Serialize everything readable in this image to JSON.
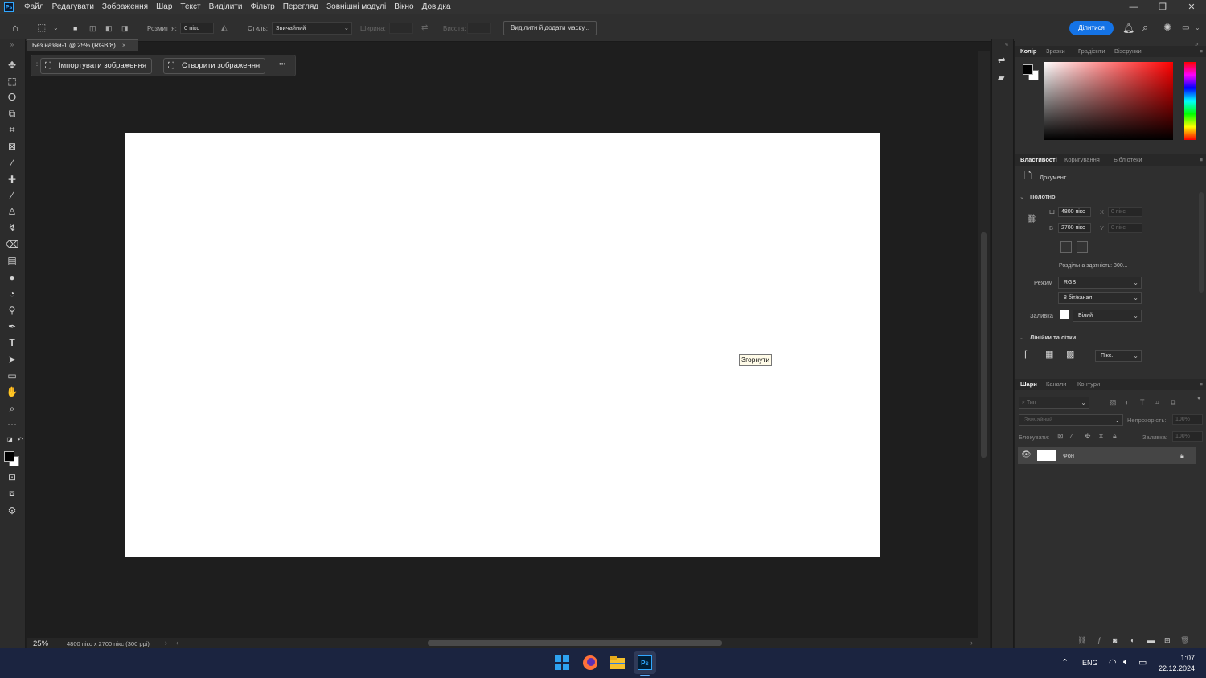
{
  "menubar": {
    "logo": "Ps",
    "items": [
      "Файл",
      "Редагувати",
      "Зображення",
      "Шар",
      "Текст",
      "Виділити",
      "Фільтр",
      "Перегляд",
      "Зовнішні модулі",
      "Вікно",
      "Довідка"
    ],
    "window_buttons": [
      "—",
      "❐",
      "✕"
    ]
  },
  "options": {
    "feather_label": "Розмиття:",
    "feather_value": "0 пікс",
    "style_label": "Стиль:",
    "style_value": "Звичайний",
    "width_label": "Ширина:",
    "height_label": "Висота:",
    "mask_button": "Виділити й додати маску...",
    "share_button": "Ділитися"
  },
  "document": {
    "tab_title": "Без назви-1 @ 25% (RGB/8)",
    "close": "×",
    "zoom": "25%",
    "info": "4800 пікс x 2700 пікс (300 ppi)"
  },
  "contextbar": {
    "import_label": "Імпортувати зображення",
    "create_label": "Створити зображення",
    "more": "•••"
  },
  "tooltip": "Згорнути",
  "color_panel": {
    "tabs": [
      "Колір",
      "Зразки",
      "Градієнти",
      "Візерунки"
    ]
  },
  "properties_panel": {
    "tabs": [
      "Властивості",
      "Коригування",
      "Бібліотеки"
    ],
    "doc_label": "Документ",
    "canvas_section": "Полотно",
    "w_label": "Ш",
    "h_label": "В",
    "width": "4800 пікс",
    "height": "2700 пікс",
    "x_label": "X",
    "y_label": "Y",
    "x_value": "0 пікс",
    "y_value": "0 пікс",
    "resolution": "Роздільна здатність: 300...",
    "mode_label": "Режим",
    "mode_value": "RGB",
    "depth_value": "8 біт/канал",
    "fill_label": "Заливка",
    "fill_value": "Білий",
    "rulers_section": "Лінійки та сітки",
    "units_value": "Пікс."
  },
  "layers_panel": {
    "tabs": [
      "Шари",
      "Канали",
      "Контури"
    ],
    "search_placeholder": "Тип",
    "blend_mode": "Звичайний",
    "opacity_label": "Непрозорість:",
    "opacity_value": "100%",
    "lock_label": "Блокувати:",
    "fill_label": "Заливка:",
    "fill_value": "100%",
    "layers": [
      {
        "name": "Фон"
      }
    ]
  },
  "taskbar": {
    "lang": "ENG",
    "time": "1:07",
    "date": "22.12.2024",
    "ps_label": "Ps"
  }
}
